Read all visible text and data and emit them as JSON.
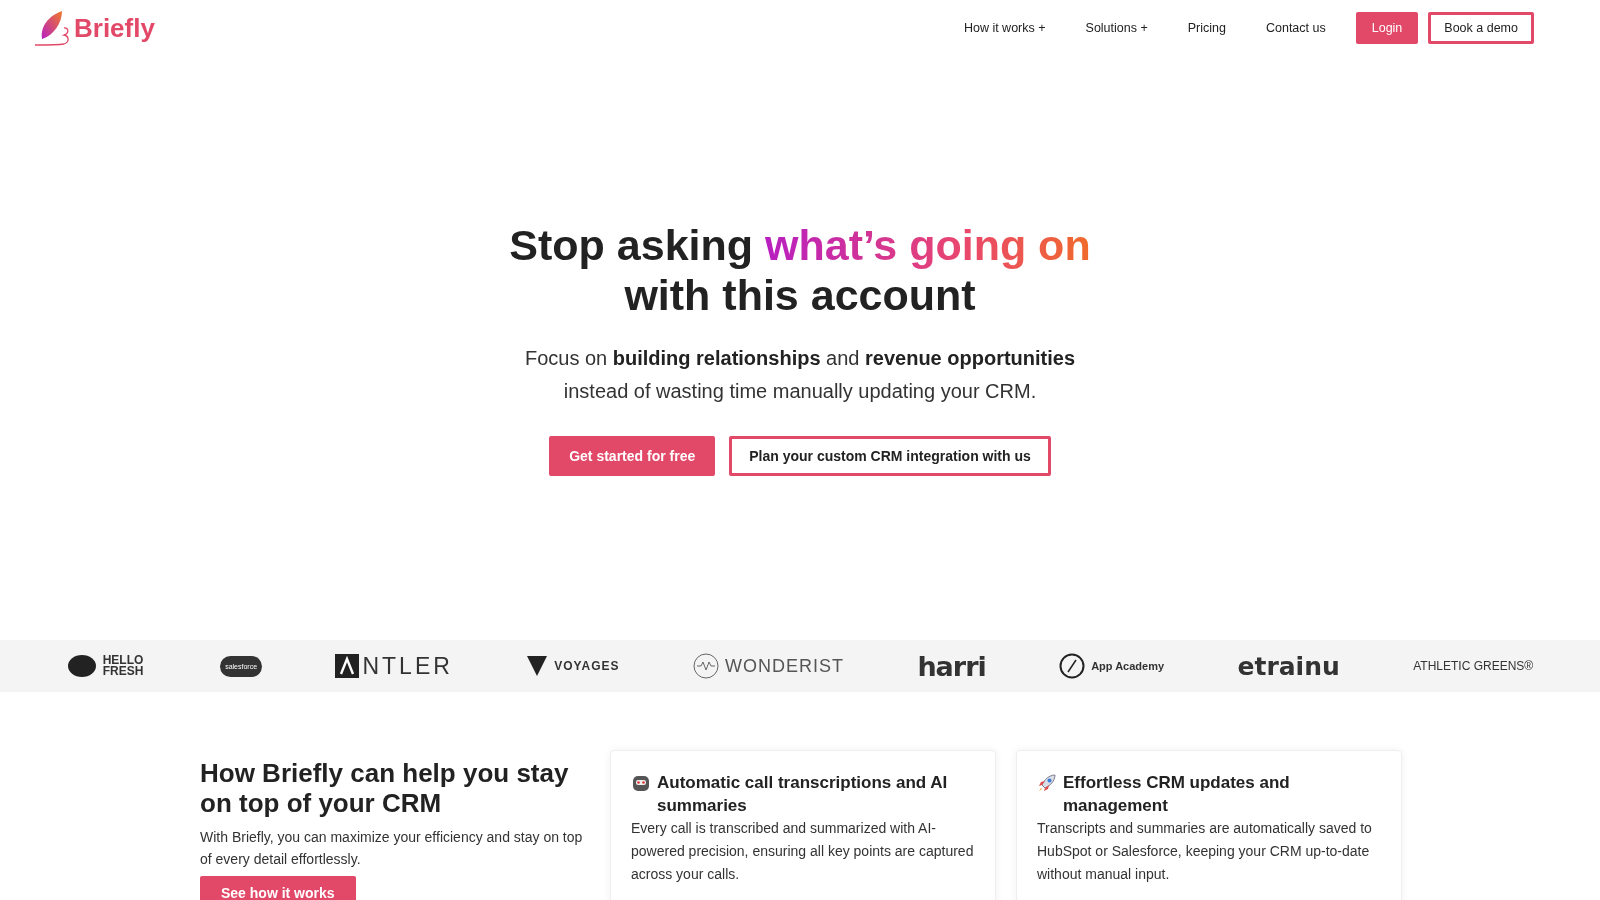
{
  "header": {
    "brand": "Briefly",
    "nav": [
      {
        "label": "How it works +",
        "kind": "link"
      },
      {
        "label": "Solutions +",
        "kind": "link"
      },
      {
        "label": "Pricing",
        "kind": "link"
      },
      {
        "label": "Contact us",
        "kind": "link"
      },
      {
        "label": "Login",
        "kind": "primary"
      },
      {
        "label": "Book a demo",
        "kind": "outline"
      }
    ]
  },
  "hero": {
    "title_start": "Stop asking ",
    "title_highlight": "what’s going on",
    "title_end": "with this account",
    "subtitle": "Focus on **building relationships** and **revenue opportunities** instead of wasting time manually updating your CRM.",
    "buttons": [
      {
        "label": "Get started for free",
        "kind": "primary"
      },
      {
        "label": "Plan your custom CRM integration with us",
        "kind": "outline"
      }
    ]
  },
  "logos": [
    {
      "text": "HELLO FRESH",
      "kind": "hellofresh"
    },
    {
      "text": "salesforce",
      "kind": "cloud"
    },
    {
      "text": "NTLER",
      "kind": "antler"
    },
    {
      "text": "VOYAGES",
      "kind": "voyages"
    },
    {
      "text": "WONDERIST",
      "kind": "wonderist"
    },
    {
      "text": "harri",
      "kind": "harri"
    },
    {
      "text": "App Academy",
      "kind": "appacademy"
    },
    {
      "text": "etrainu",
      "kind": "etrainu"
    },
    {
      "text": "ATHLETIC GREENS®",
      "kind": "athletic"
    }
  ],
  "features": {
    "title": "How Briefly can help you stay on top of your CRM",
    "text": "With Briefly, you can maximize your efficiency and stay on top of every detail effortlessly.",
    "button": "See how it works",
    "cards": [
      {
        "kind": "robot",
        "title": "Automatic call transcriptions and AI summaries",
        "text": "Every call is transcribed and summarized with AI-powered precision, ensuring all key points are captured across your calls."
      },
      {
        "kind": "rocket",
        "title": "Effortless CRM updates and management",
        "text": "Transcripts and summaries are automatically saved to HubSpot or Salesforce, keeping your CRM up-to-date without manual input."
      }
    ]
  }
}
